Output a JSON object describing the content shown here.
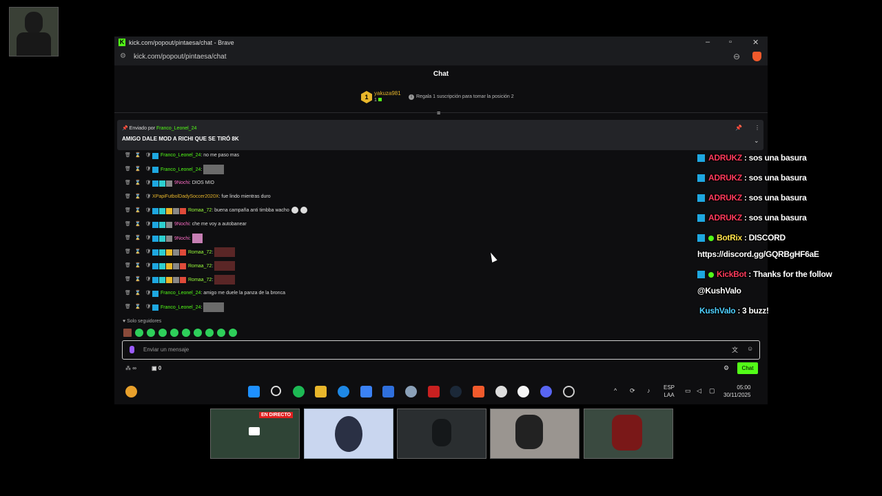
{
  "window": {
    "title": "kick.com/popout/pintaesa/chat - Brave",
    "url": "kick.com/popout/pintaesa/chat"
  },
  "chat": {
    "header": "Chat",
    "leader": {
      "rank": "1",
      "name": "yakuza981",
      "count": "1",
      "message": "Regala 1 suscripción para tomar la posición 2"
    },
    "pinned": {
      "by_prefix": "Enviado por",
      "by_user": "Franco_Leonel_24",
      "text": "AMIGO DALE MOD A RICHI QUE SE TIRÓ 8K"
    },
    "messages": [
      {
        "user": "Franco_Leonel_24",
        "color": "#53fc18",
        "text": "no me paso mas",
        "badges": [
          "#1ea7e0"
        ],
        "media": ""
      },
      {
        "user": "Franco_Leonel_24",
        "color": "#53fc18",
        "text": "",
        "badges": [
          "#1ea7e0"
        ],
        "media": "gray"
      },
      {
        "user": "9Nochi",
        "color": "#ff6ec7",
        "text": "DIOS MIO",
        "badges": [
          "#1ea7e0",
          "#2ecfcf",
          "#888"
        ],
        "media": ""
      },
      {
        "user": "XPapiFutbolDadySoccer2020X",
        "color": "#e8b62b",
        "text": "fue lindo mientras duro",
        "badges": [],
        "media": ""
      },
      {
        "user": "Romaa_72",
        "color": "#9bff3c",
        "text": "buena campaña anti timbba wacho",
        "badges": [
          "#1ea7e0",
          "#2ecfcf",
          "#e8b62b",
          "#888",
          "#e04b3a"
        ],
        "media": "emotes"
      },
      {
        "user": "9Nochi",
        "color": "#ff6ec7",
        "text": "che me voy a autobanear",
        "badges": [
          "#1ea7e0",
          "#2ecfcf",
          "#888"
        ],
        "media": ""
      },
      {
        "user": "9Nochi",
        "color": "#ff6ec7",
        "text": "",
        "badges": [
          "#1ea7e0",
          "#2ecfcf",
          "#888"
        ],
        "media": "pink"
      },
      {
        "user": "Romaa_72",
        "color": "#9bff3c",
        "text": "",
        "badges": [
          "#1ea7e0",
          "#2ecfcf",
          "#e8b62b",
          "#888",
          "#e04b3a"
        ],
        "media": "dark"
      },
      {
        "user": "Romaa_72",
        "color": "#9bff3c",
        "text": "",
        "badges": [
          "#1ea7e0",
          "#2ecfcf",
          "#e8b62b",
          "#888",
          "#e04b3a"
        ],
        "media": "dark"
      },
      {
        "user": "Romaa_72",
        "color": "#9bff3c",
        "text": "",
        "badges": [
          "#1ea7e0",
          "#2ecfcf",
          "#e8b62b",
          "#888",
          "#e04b3a"
        ],
        "media": "dark"
      },
      {
        "user": "Franco_Leonel_24",
        "color": "#53fc18",
        "text": "amigo me duele la panza de la bronca",
        "badges": [
          "#1ea7e0"
        ],
        "media": ""
      },
      {
        "user": "Franco_Leonel_24",
        "color": "#53fc18",
        "text": "",
        "badges": [
          "#1ea7e0"
        ],
        "media": "gray"
      }
    ],
    "followers_only": "♥ Solo seguidores",
    "input_placeholder": "Enviar un mensaje",
    "viewers_label": "∞",
    "gift_count": "0",
    "chat_button": "Chat"
  },
  "taskbar": {
    "lang": "ESP",
    "lang2": "LAA",
    "time": "05:00",
    "date": "30/11/2025"
  },
  "overlay": [
    {
      "user": "ADRUKZ",
      "text": " : sos una basura",
      "color": "red"
    },
    {
      "user": "ADRUKZ",
      "text": " : sos una basura",
      "color": "red"
    },
    {
      "user": "ADRUKZ",
      "text": " : sos una basura",
      "color": "red"
    },
    {
      "user": "ADRUKZ",
      "text": " : sos una basura",
      "color": "red"
    },
    {
      "user": "BotRix",
      "text": " : DISCORD",
      "color": "yel"
    },
    {
      "user": "",
      "text": "https://discord.gg/GQRBgHF6aE",
      "color": ""
    },
    {
      "user": "KickBot",
      "text": " : Thanks for the follow",
      "color": "red"
    },
    {
      "user": "",
      "text": "@KushValo",
      "color": ""
    },
    {
      "user": "KushValo",
      "text": " : 3 buzz!",
      "color": "blu"
    }
  ],
  "thumbnails": {
    "live_label": "EN DIRECTO"
  }
}
